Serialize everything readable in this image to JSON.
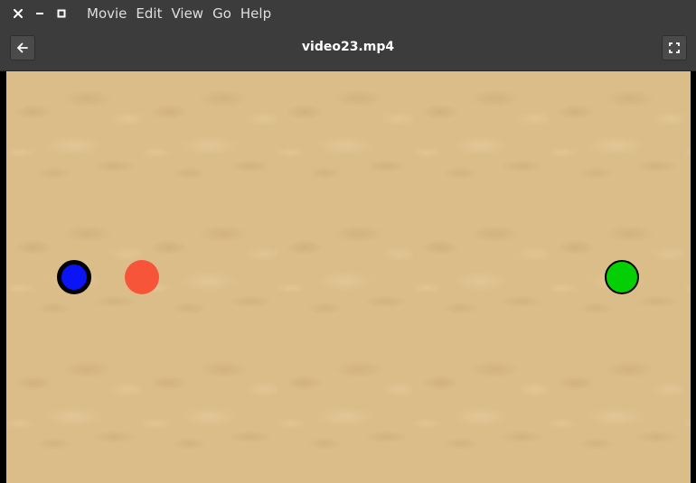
{
  "window": {
    "controls": {
      "close_icon": "close-icon",
      "minimize_icon": "minimize-icon",
      "maximize_icon": "maximize-icon"
    }
  },
  "menubar": {
    "items": [
      {
        "label": "Movie"
      },
      {
        "label": "Edit"
      },
      {
        "label": "View"
      },
      {
        "label": "Go"
      },
      {
        "label": "Help"
      }
    ]
  },
  "header": {
    "title": "video23.mp4",
    "back_icon": "arrow-left-icon",
    "fullscreen_icon": "fullscreen-icon"
  },
  "video": {
    "background": "sand texture",
    "objects": [
      {
        "name": "blue-ball",
        "fill": "#0a14f5",
        "outline": "#000000"
      },
      {
        "name": "red-ball",
        "fill": "#f65539",
        "outline": "none"
      },
      {
        "name": "green-ball",
        "fill": "#04cf04",
        "outline": "#000000"
      }
    ]
  },
  "colors": {
    "chrome": "#3c3c3c",
    "button": "#4a4a4a",
    "title_text": "#ffffff",
    "menu_text": "#dfdfdf"
  }
}
